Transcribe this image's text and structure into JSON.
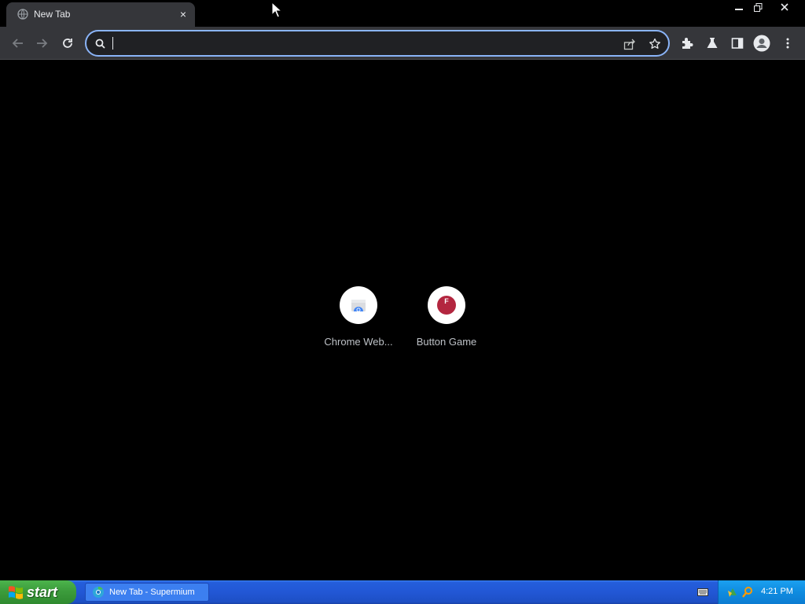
{
  "tab": {
    "title": "New Tab",
    "close_glyph": "×"
  },
  "window_controls": [
    "minimize-icon",
    "restore-icon",
    "close-icon"
  ],
  "toolbar": {
    "back_icon": "arrow-left-icon",
    "forward_icon": "arrow-right-icon",
    "reload_icon": "reload-icon"
  },
  "omnibox": {
    "value": "",
    "placeholder": ""
  },
  "toolbar_right_icons": [
    "share-icon",
    "star-icon",
    "extensions-icon",
    "labs-icon",
    "side-panel-icon",
    "profile-icon",
    "menu-icon"
  ],
  "shortcuts": [
    {
      "label": "Chrome Web...",
      "icon": "chrome-web-store-icon"
    },
    {
      "label": "Button Game",
      "icon": "button-game-icon",
      "glyph": "F"
    }
  ],
  "taskbar": {
    "start_label": "start",
    "task_label": "New Tab - Supermium",
    "clock": "4:21 PM"
  },
  "colors": {
    "accent": "#8ab4f8",
    "toolbar_bg": "#35363a",
    "omnibox_bg": "#202124",
    "button_game": "#b3263f"
  }
}
